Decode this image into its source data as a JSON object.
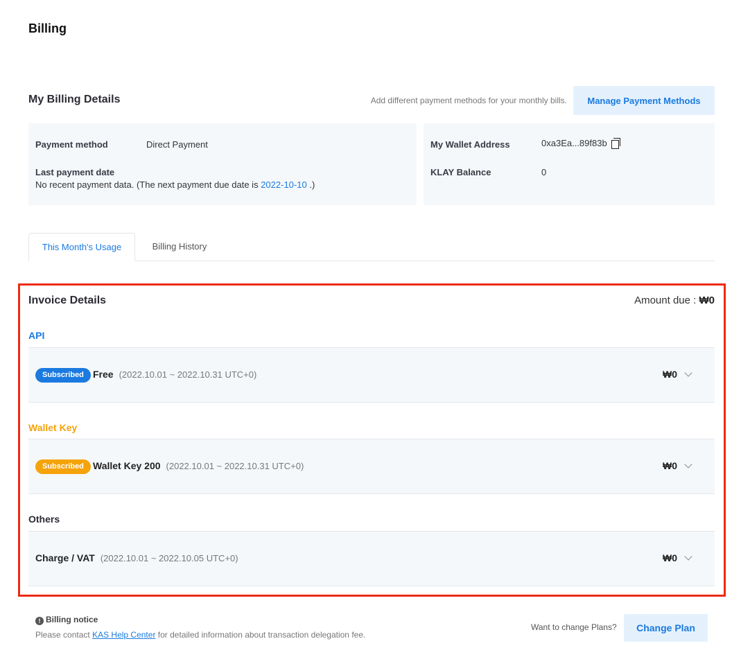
{
  "page": {
    "title": "Billing"
  },
  "billing_details": {
    "title": "My Billing Details",
    "hint": "Add different payment methods for your monthly bills.",
    "manage_button": "Manage Payment Methods",
    "payment_method_label": "Payment method",
    "payment_method_value": "Direct Payment",
    "last_payment_label": "Last payment date",
    "last_payment_text_prefix": "No recent payment data. (The next payment due date is",
    "next_due_date": "2022-10-10",
    "last_payment_text_suffix": ".)",
    "wallet_address_label": "My Wallet Address",
    "wallet_address_value": "0xa3Ea...89f83b",
    "klay_balance_label": "KLAY Balance",
    "klay_balance_value": "0"
  },
  "tabs": [
    {
      "label": "This Month's Usage",
      "active": true
    },
    {
      "label": "Billing History",
      "active": false
    }
  ],
  "invoice": {
    "title": "Invoice Details",
    "amount_due_label": "Amount due :",
    "amount_due_value": "₩0",
    "categories": [
      {
        "name": "API",
        "color": "#1a7ae0",
        "item": {
          "badge": "Subscribed",
          "name": "Free",
          "period": "(2022.10.01 ~ 2022.10.31 UTC+0)",
          "price": "₩0"
        }
      },
      {
        "name": "Wallet Key",
        "color": "#f5a30a",
        "item": {
          "badge": "Subscribed",
          "name": "Wallet Key 200",
          "period": "(2022.10.01 ~ 2022.10.31 UTC+0)",
          "price": "₩0"
        }
      },
      {
        "name": "Others",
        "color": "#2b2b35",
        "item": {
          "name": "Charge / VAT",
          "period": "(2022.10.01 ~ 2022.10.05 UTC+0)",
          "price": "₩0"
        }
      }
    ]
  },
  "notice": {
    "icon": "info-icon",
    "title": "Billing notice",
    "text_prefix": "Please contact",
    "link": "KAS Help Center",
    "text_suffix": "for detailed information about transaction delegation fee."
  },
  "change_plan": {
    "hint": "Want to change Plans?",
    "button": "Change Plan"
  }
}
